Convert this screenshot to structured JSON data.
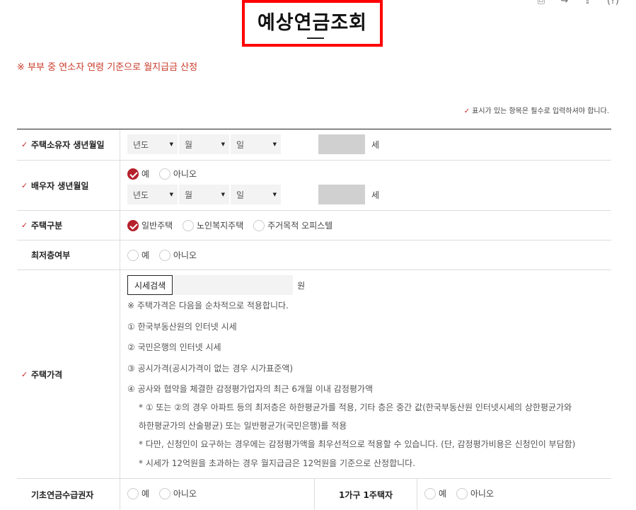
{
  "header": {
    "title": "예상연금조회",
    "icons": [
      "print-icon",
      "share-icon",
      "export-icon",
      "help-icon"
    ]
  },
  "notice": "※ 부부 중 연소자 연령 기준으로 월지급금 산정",
  "required_note": "표시가 있는 항목은 필수로 입력하셔야 합니다.",
  "form": {
    "owner_birth": {
      "label": "주택소유자 생년월일",
      "year": "년도",
      "month": "월",
      "day": "일",
      "age_unit": "세"
    },
    "spouse_birth": {
      "label": "배우자 생년월일",
      "yes": "예",
      "no": "아니오",
      "selected": "예",
      "year": "년도",
      "month": "월",
      "day": "일",
      "age_unit": "세"
    },
    "house_type": {
      "label": "주택구분",
      "options": [
        "일반주택",
        "노인복지주택",
        "주거목적 오피스텔"
      ],
      "selected": "일반주택"
    },
    "lowest_floor": {
      "label": "최저층여부",
      "yes": "예",
      "no": "아니오"
    },
    "house_price": {
      "label": "주택가격",
      "search_button": "시세검색",
      "unit": "원",
      "intro": "※ 주택가격은 다음을 순차적으로 적용합니다.",
      "items": [
        "① 한국부동산원의 인터넷 시세",
        "② 국민은행의 인터넷 시세",
        "③ 공시가격(공시가격이 없는 경우 시가표준액)",
        "④ 공사와 협약을 체결한 감정평가업자의 최근 6개월 이내 감정평가액"
      ],
      "notes": [
        "* ① 또는 ②의 경우 아파트 등의 최저층은 하한평균가를 적용, 기타 층은 중간 값(한국부동산원 인터넷시세의 상한평균가와",
        "하한평균가의 산술평균) 또는 일반평균가(국민은행)를 적용",
        "* 다만, 신청인이 요구하는 경우에는 감정평가액을 최우선적으로 적용할 수 있습니다. (단, 감정평가비용은 신청인이 부담함)",
        "* 시세가 12억원을 초과하는 경우 월지급금은 12억원을 기준으로 산정합니다."
      ]
    },
    "basic_pension": {
      "label": "기초연금수급권자",
      "yes": "예",
      "no": "아니오"
    },
    "single_house": {
      "label": "1가구 1주택자",
      "yes": "예",
      "no": "아니오"
    }
  }
}
